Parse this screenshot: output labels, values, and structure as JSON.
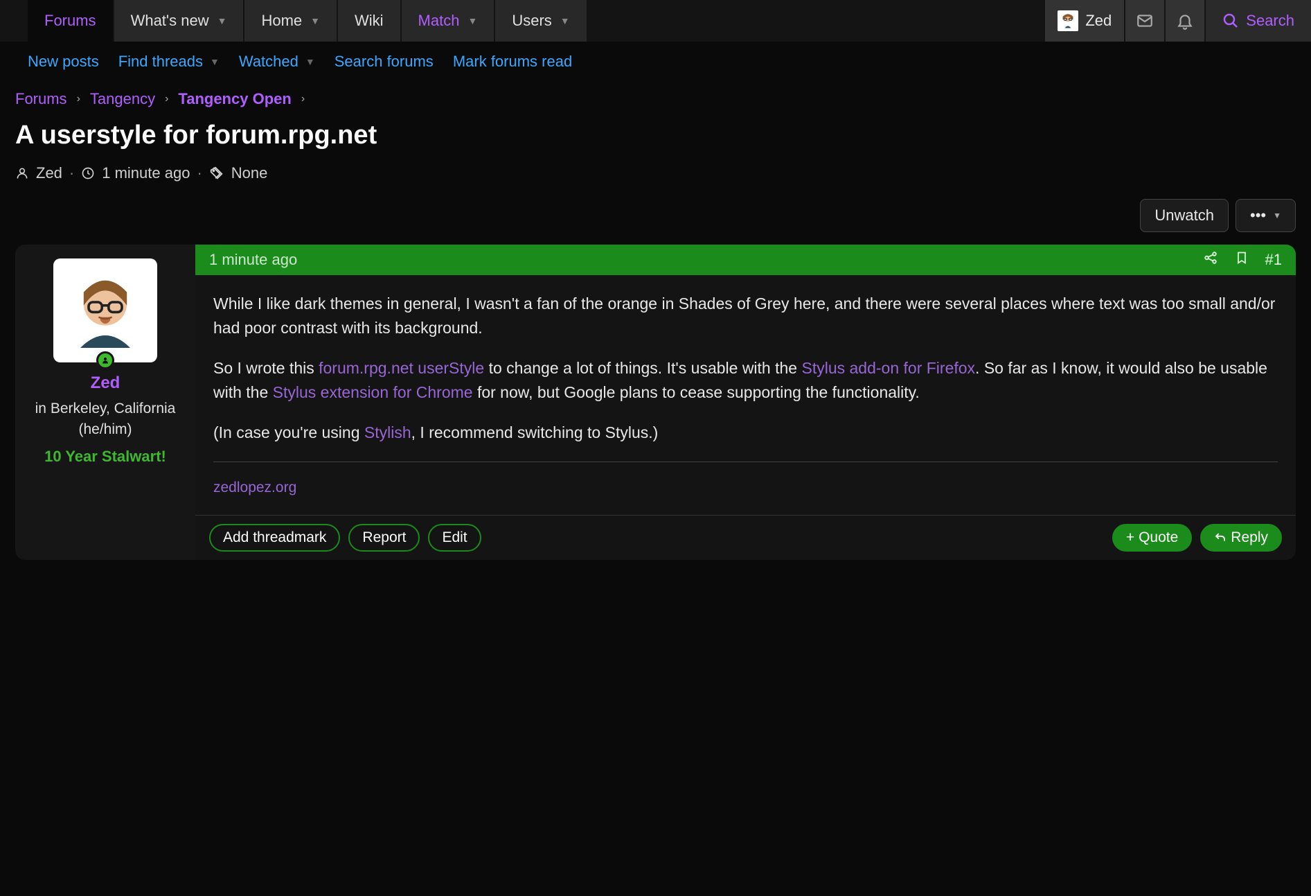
{
  "nav": {
    "tabs": [
      {
        "label": "Forums",
        "active": true,
        "purple": true,
        "chev": false
      },
      {
        "label": "What's new",
        "chev": true
      },
      {
        "label": "Home",
        "chev": true
      },
      {
        "label": "Wiki",
        "chev": false
      },
      {
        "label": "Match",
        "chev": true,
        "purple": true
      },
      {
        "label": "Users",
        "chev": true
      }
    ],
    "user": "Zed",
    "search": "Search"
  },
  "subnav": {
    "items": [
      {
        "label": "New posts",
        "chev": false
      },
      {
        "label": "Find threads",
        "chev": true
      },
      {
        "label": "Watched",
        "chev": true
      },
      {
        "label": "Search forums",
        "chev": false
      },
      {
        "label": "Mark forums read",
        "chev": false
      }
    ]
  },
  "breadcrumb": [
    {
      "label": "Forums"
    },
    {
      "label": "Tangency"
    },
    {
      "label": "Tangency Open",
      "current": true
    }
  ],
  "thread": {
    "title": "A userstyle for forum.rpg.net",
    "author": "Zed",
    "time": "1 minute ago",
    "tags": "None"
  },
  "actions": {
    "unwatch": "Unwatch",
    "more": "•••"
  },
  "post": {
    "time": "1 minute ago",
    "number": "#1",
    "user": {
      "name": "Zed",
      "title": "in Berkeley, California",
      "pronouns": "(he/him)",
      "badge": "10 Year Stalwart!"
    },
    "body": {
      "p1": "While I like dark themes in general, I wasn't a fan of the orange in Shades of Grey here, and there were several places where text was too small and/or had poor contrast with its background.",
      "p2a": "So I wrote this ",
      "link1": "forum.rpg.net userStyle",
      "p2b": " to change a lot of things. It's usable with the ",
      "link2": "Stylus add-on for Firefox",
      "p2c": ". So far as I know, it would also be usable with the ",
      "link3": "Stylus extension for Chrome",
      "p2d": " for now, but Google plans to cease supporting the functionality.",
      "p3a": "(In case you're using ",
      "link4": "Stylish",
      "p3b": ", I recommend switching to Stylus.)",
      "sig": "zedlopez.org"
    },
    "actions": {
      "threadmark": "Add threadmark",
      "report": "Report",
      "edit": "Edit",
      "quote": "Quote",
      "reply": "Reply"
    }
  }
}
